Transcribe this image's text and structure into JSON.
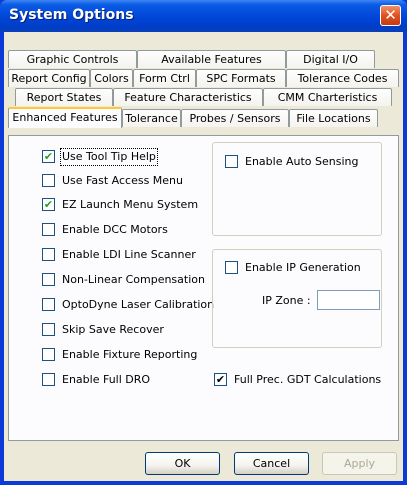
{
  "window": {
    "title": "System Options"
  },
  "tabs": {
    "row1": [
      "Graphic Controls",
      "Available Features",
      "Digital I/O"
    ],
    "row2": [
      "Report Config",
      "Colors",
      "Form Ctrl",
      "SPC Formats",
      "Tolerance Codes"
    ],
    "row3": [
      "Report States",
      "Feature Characteristics",
      "CMM Charteristics"
    ],
    "row4": [
      "Enhanced Features",
      "Tolerance",
      "Probes / Sensors",
      "File Locations"
    ],
    "active": "Enhanced Features"
  },
  "options": [
    {
      "label": "Use Tool Tip Help",
      "checked": true
    },
    {
      "label": "Use Fast Access Menu",
      "checked": false
    },
    {
      "label": "EZ Launch Menu System",
      "checked": true
    },
    {
      "label": "Enable DCC Motors",
      "checked": false
    },
    {
      "label": "Enable LDI Line Scanner",
      "checked": false
    },
    {
      "label": "Non-Linear Compensation",
      "checked": false
    },
    {
      "label": "OptoDyne Laser Calibration",
      "checked": false
    },
    {
      "label": "Skip Save Recover",
      "checked": false
    },
    {
      "label": "Enable Fixture Reporting",
      "checked": false
    },
    {
      "label": "Enable Full DRO",
      "checked": false
    }
  ],
  "auto_sensing": {
    "label": "Enable Auto Sensing",
    "checked": false
  },
  "ip_generation": {
    "label": "Enable IP Generation",
    "checked": false,
    "zone_label": "IP Zone :",
    "zone_value": ""
  },
  "gdt": {
    "label": "Full Prec. GDT Calculations",
    "checked": true
  },
  "buttons": {
    "ok": "OK",
    "cancel": "Cancel",
    "apply": "Apply"
  }
}
